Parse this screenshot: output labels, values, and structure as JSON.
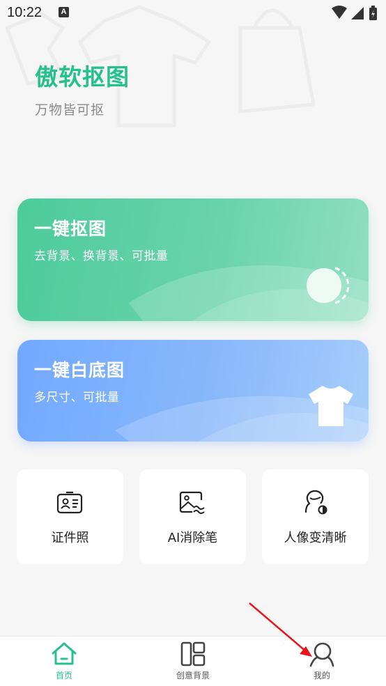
{
  "status_bar": {
    "time": "10:22",
    "notification_icon": "A"
  },
  "header": {
    "title": "傲软抠图",
    "subtitle": "万物皆可抠"
  },
  "cards": [
    {
      "title": "一键抠图",
      "subtitle": "去背景、换背景、可批量",
      "color": "#4ccb9b",
      "icon": "toggle-circle-icon"
    },
    {
      "title": "一键白底图",
      "subtitle": "多尺寸、可批量",
      "color": "#72a8ff",
      "icon": "tshirt-icon"
    }
  ],
  "tools": [
    {
      "label": "证件照",
      "icon": "id-card-icon"
    },
    {
      "label": "AI消除笔",
      "icon": "image-eraser-icon"
    },
    {
      "label": "人像变清晰",
      "icon": "portrait-enhance-icon"
    }
  ],
  "bottom_nav": [
    {
      "label": "首页",
      "icon": "home-icon",
      "active": true
    },
    {
      "label": "创意背景",
      "icon": "layout-icon",
      "active": false
    },
    {
      "label": "我的",
      "icon": "user-icon",
      "active": false
    }
  ],
  "colors": {
    "accent": "#25c08d",
    "annotation_arrow": "#e8161c"
  }
}
